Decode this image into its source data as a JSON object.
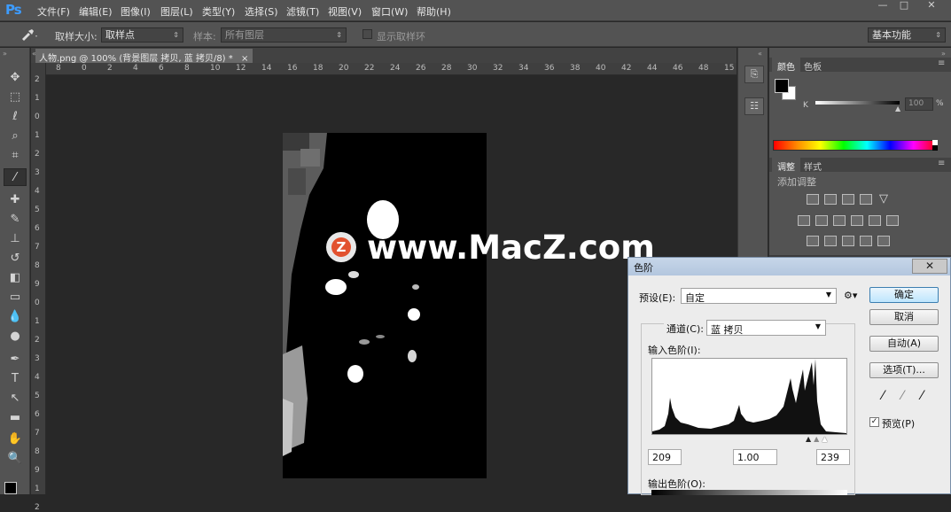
{
  "app": {
    "logo": "Ps"
  },
  "menu": [
    "文件(F)",
    "编辑(E)",
    "图像(I)",
    "图层(L)",
    "类型(Y)",
    "选择(S)",
    "滤镜(T)",
    "视图(V)",
    "窗口(W)",
    "帮助(H)"
  ],
  "window_controls": [
    "—",
    "□",
    "✕"
  ],
  "options": {
    "sample_size_label": "取样大小:",
    "sample_size_value": "取样点",
    "sample_label": "样本:",
    "sample_value": "所有图层",
    "show_ring_label": "显示取样环",
    "workspace": "基本功能"
  },
  "document": {
    "tab_title": "人物.png @ 100% (背景图层 拷贝, 蓝 拷贝/8) *",
    "close": "×",
    "ruler_top": [
      "8",
      "0",
      "2",
      "4",
      "6",
      "8",
      "10",
      "12",
      "14",
      "16",
      "18",
      "20",
      "22",
      "24",
      "26",
      "28",
      "30",
      "32",
      "34",
      "36",
      "38",
      "40",
      "42",
      "44",
      "46",
      "48",
      "15"
    ],
    "ruler_left": [
      "2",
      "1",
      "0",
      "1",
      "2",
      "3",
      "4",
      "5",
      "6",
      "7",
      "8",
      "9",
      "0",
      "1",
      "2",
      "3",
      "4",
      "5",
      "6",
      "7",
      "8",
      "9",
      "1",
      "2"
    ]
  },
  "watermark": {
    "badge": "Z",
    "text": "www.MacZ.com"
  },
  "color_panel": {
    "tabs": [
      "颜色",
      "色板"
    ],
    "channel_label": "K",
    "value": "100",
    "unit": "%"
  },
  "adjust_panel": {
    "tabs": [
      "调整",
      "样式"
    ],
    "add_label": "添加调整"
  },
  "levels_dialog": {
    "title": "色阶",
    "close": "✕",
    "preset_label": "预设(E):",
    "preset_value": "自定",
    "channel_label": "通道(C):",
    "channel_value": "蓝 拷贝",
    "input_label": "输入色阶(I):",
    "input_black": "209",
    "input_gamma": "1.00",
    "input_white": "239",
    "output_label": "输出色阶(O):",
    "buttons": {
      "ok": "确定",
      "cancel": "取消",
      "auto": "自动(A)",
      "options": "选项(T)..."
    },
    "preview_label": "预览(P)",
    "preview_checked": "✓"
  }
}
